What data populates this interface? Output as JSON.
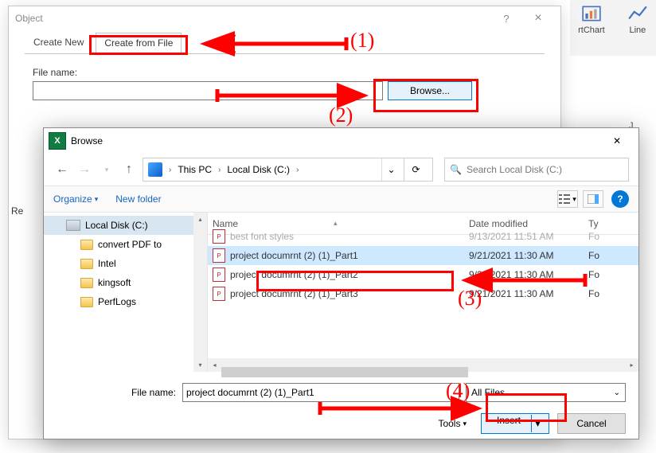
{
  "ribbon": {
    "chart_label": "rtChart",
    "line_label": "Line"
  },
  "object_dialog": {
    "title": "Object",
    "help": "?",
    "close": "×",
    "tab_create_new": "Create New",
    "tab_create_from_file": "Create from File",
    "filename_label": "File name:",
    "filename_value": "",
    "browse_label": "Browse..."
  },
  "result_label": "Re",
  "browse": {
    "title": "Browse",
    "close": "✕",
    "back": "←",
    "fwd": "→",
    "up": "↑",
    "path_root": "This PC",
    "path_drive": "Local Disk (C:)",
    "refresh": "⟳",
    "search_placeholder": "Search Local Disk (C:)",
    "organize": "Organize",
    "newfolder": "New folder",
    "help": "?",
    "tree": [
      {
        "label": "Local Disk (C:)",
        "type": "drive",
        "selected": true
      },
      {
        "label": "convert PDF to",
        "type": "folder"
      },
      {
        "label": "Intel",
        "type": "folder"
      },
      {
        "label": "kingsoft",
        "type": "folder"
      },
      {
        "label": "PerfLogs",
        "type": "folder"
      }
    ],
    "columns": {
      "name": "Name",
      "date": "Date modified",
      "type": "Ty"
    },
    "rows": [
      {
        "name": "best font styles",
        "date": "9/13/2021 11:51 AM",
        "ty": "Fo",
        "cut": true
      },
      {
        "name": "project documrnt (2) (1)_Part1",
        "date": "9/21/2021 11:30 AM",
        "ty": "Fo",
        "selected": true
      },
      {
        "name": "project documrnt (2) (1)_Part2",
        "date": "9/21/2021 11:30 AM",
        "ty": "Fo"
      },
      {
        "name": "project documrnt (2) (1)_Part3",
        "date": "9/21/2021 11:30 AM",
        "ty": "Fo"
      }
    ],
    "filename_label": "File name:",
    "filename_value": "project documrnt (2) (1)_Part1",
    "filter": "All Files",
    "tools": "Tools",
    "insert": "Insert",
    "cancel": "Cancel"
  },
  "anno": {
    "n1": "(1)",
    "n2": "(2)",
    "n3": "(3)",
    "n4": "(4)"
  },
  "grid_col": "J"
}
